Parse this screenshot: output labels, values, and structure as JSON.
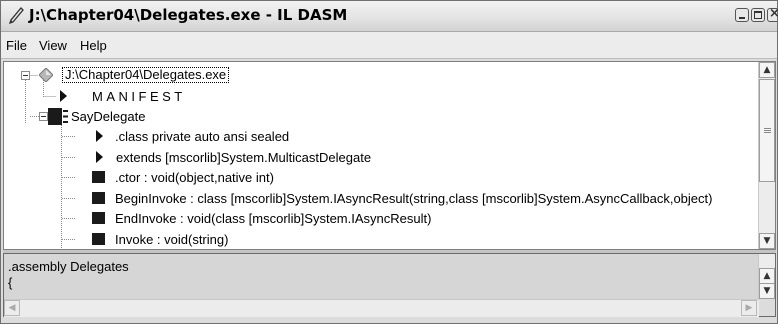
{
  "window": {
    "title": "J:\\Chapter04\\Delegates.exe - IL DASM",
    "title_icon": "pencil-icon",
    "buttons": [
      "minimize-icon",
      "maximize-icon",
      "close-icon"
    ]
  },
  "menu": {
    "items": [
      {
        "label": "File"
      },
      {
        "label": "View"
      },
      {
        "label": "Help"
      }
    ]
  },
  "tree": {
    "root": {
      "label": "J:\\Chapter04\\Delegates.exe",
      "icon": "assembly-diamond-icon",
      "expanded": true
    },
    "manifest": {
      "label": "MANIFEST",
      "icon": "triangle-right-icon"
    },
    "class": {
      "label": "SayDelegate",
      "icon": "class-icon",
      "expanded": true
    },
    "members": [
      {
        "label": ".class private auto ansi sealed",
        "icon": "triangle-right-icon"
      },
      {
        "label": "extends [mscorlib]System.MulticastDelegate",
        "icon": "triangle-right-icon"
      },
      {
        "label": ".ctor : void(object,native int)",
        "icon": "method-icon"
      },
      {
        "label": "BeginInvoke : class [mscorlib]System.IAsyncResult(string,class [mscorlib]System.AsyncCallback,object)",
        "icon": "method-icon"
      },
      {
        "label": "EndInvoke : void(class [mscorlib]System.IAsyncResult)",
        "icon": "method-icon"
      },
      {
        "label": "Invoke : void(string)",
        "icon": "method-icon"
      }
    ]
  },
  "detail": {
    "lines": [
      ".assembly Delegates",
      "{"
    ]
  },
  "colors": {
    "icon_dark": "#1a1a1a",
    "diamond": "#9a9a9a",
    "tree_bg": "#ffffff",
    "detail_bg": "#d6d6d6"
  }
}
